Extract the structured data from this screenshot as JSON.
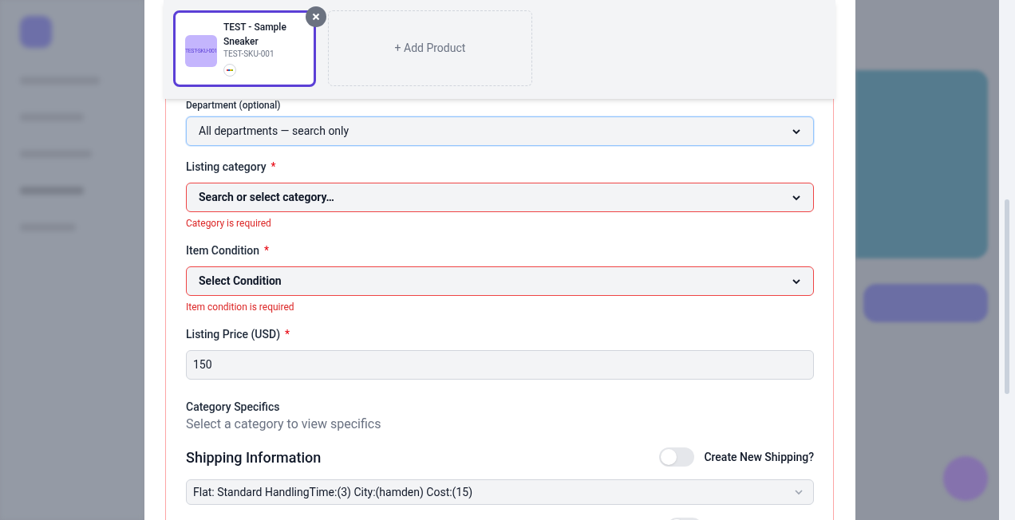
{
  "product_strip": {
    "products": [
      {
        "title": "TEST - Sample Sneaker",
        "sku": "TEST-SKU-001",
        "thumbnail_text": "TEST-SKU-001",
        "selected": true
      }
    ],
    "add_button": "+ Add Product"
  },
  "fields": [
    {
      "label": "Department (optional)",
      "kind": "select",
      "value": "All departments — search only",
      "invalid": false,
      "focused": true
    },
    {
      "label": "Listing category",
      "required_mark": "*",
      "kind": "select",
      "placeholder": "Search or select category…",
      "invalid": true,
      "focused": false,
      "error": "Category is required"
    },
    {
      "label": "Item Condition",
      "required_mark": "*",
      "kind": "select",
      "placeholder": "Select Condition",
      "invalid": true,
      "focused": false,
      "error": "Item condition is required"
    },
    {
      "label": "Listing Price (USD)",
      "required_mark": "*",
      "kind": "input",
      "value": "150",
      "invalid": false,
      "focused": false
    }
  ],
  "category_specifics": {
    "label": "Category Specifics",
    "hint": "Select a category to view specifics"
  },
  "shipping": {
    "title": "Shipping Information",
    "toggle": {
      "label": "Create New Shipping?",
      "on": false
    },
    "policy": "Flat: Standard HandlingTime:(3) City:(hamden) Cost:(15)"
  },
  "next_row": {
    "on": false
  }
}
